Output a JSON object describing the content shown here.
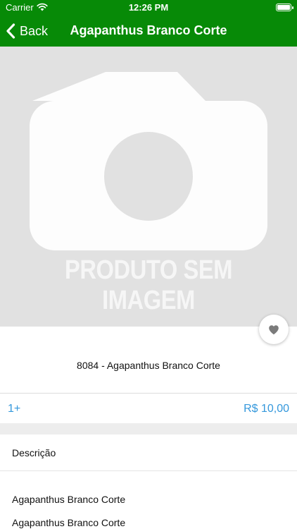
{
  "status_bar": {
    "carrier": "Carrier",
    "time": "12:26 PM",
    "battery_level_percent": 100,
    "icons": [
      "wifi-icon",
      "battery-icon"
    ]
  },
  "nav_bar": {
    "back_label": "Back",
    "title": "Agapanthus Branco Corte",
    "icon": "chevron-left-icon"
  },
  "product": {
    "placeholder_text": "PRODUTO SEM IMAGEM",
    "placeholder_icon": "camera-icon",
    "favorite_icon": "heart-icon",
    "name": "8084 - Agapanthus Branco Corte",
    "quantity": "1+",
    "price": "R$ 10,00"
  },
  "description": {
    "title": "Descrição",
    "lines": [
      "Agapanthus Branco Corte",
      "Agapanthus Branco Corte"
    ]
  },
  "colors": {
    "header_green": "#078a07",
    "accent_blue": "#3598dc",
    "placeholder_bg": "#e1e1e1"
  }
}
